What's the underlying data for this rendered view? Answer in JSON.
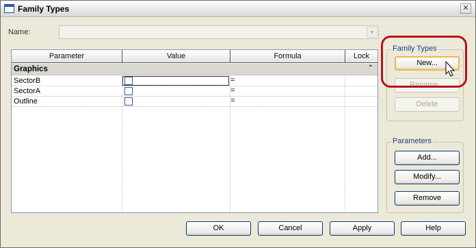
{
  "window": {
    "title": "Family Types"
  },
  "name_field": {
    "label": "Name:",
    "value": ""
  },
  "grid": {
    "columns": [
      "Parameter",
      "Value",
      "Formula",
      "Lock"
    ],
    "group": {
      "label": "Graphics",
      "collapse_glyph": "⌃"
    },
    "rows": [
      {
        "name": "SectorB",
        "formula": "="
      },
      {
        "name": "SectorA",
        "formula": "="
      },
      {
        "name": "Outline",
        "formula": "="
      }
    ]
  },
  "family_types": {
    "caption": "Family Types",
    "new_label": "New...",
    "rename_label": "Rename...",
    "delete_label": "Delete"
  },
  "parameters": {
    "caption": "Parameters",
    "add_label": "Add...",
    "modify_label": "Modify...",
    "remove_label": "Remove"
  },
  "footer": {
    "ok_label": "OK",
    "cancel_label": "Cancel",
    "apply_label": "Apply",
    "help_label": "Help"
  },
  "colors": {
    "highlight": "#b8141c",
    "group_caption": "#1a3c8a"
  }
}
